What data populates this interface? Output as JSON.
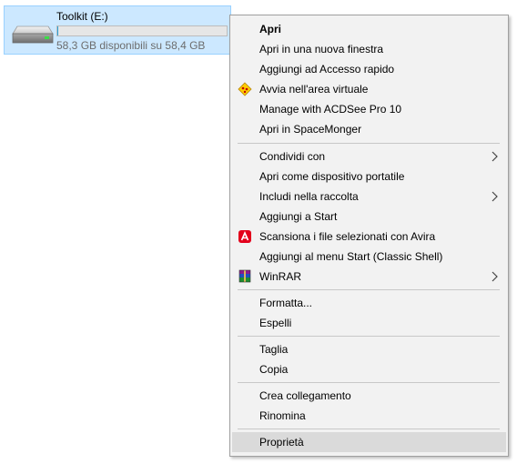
{
  "drive": {
    "name": "Toolkit (E:)",
    "free_text": "58,3 GB disponibili su 58,4 GB",
    "used_fraction": 0.002
  },
  "menu": {
    "items": [
      {
        "label": "Apri",
        "bold": true
      },
      {
        "label": "Apri in una nuova finestra"
      },
      {
        "label": "Aggiungi ad Accesso rapido"
      },
      {
        "label": "Avvia nell'area virtuale",
        "icon": "virtual-area-icon"
      },
      {
        "label": "Manage with ACDSee Pro 10"
      },
      {
        "label": "Apri in SpaceMonger"
      },
      {
        "label": "Condividi con",
        "submenu": true
      },
      {
        "label": "Apri come dispositivo portatile"
      },
      {
        "label": "Includi nella raccolta",
        "submenu": true
      },
      {
        "label": "Aggiungi a Start"
      },
      {
        "label": "Scansiona i file selezionati con Avira",
        "icon": "avira-icon"
      },
      {
        "label": "Aggiungi al menu Start (Classic Shell)"
      },
      {
        "label": "WinRAR",
        "icon": "winrar-icon",
        "submenu": true
      },
      {
        "label": "Formatta..."
      },
      {
        "label": "Espelli"
      },
      {
        "label": "Taglia"
      },
      {
        "label": "Copia"
      },
      {
        "label": "Crea collegamento"
      },
      {
        "label": "Rinomina"
      },
      {
        "label": "Proprietà",
        "hovered": true
      }
    ]
  },
  "colors": {
    "selection_bg": "#cce8ff",
    "menu_bg": "#f2f2f2",
    "hover_bg": "#dadada",
    "avira_red": "#e3001b"
  }
}
